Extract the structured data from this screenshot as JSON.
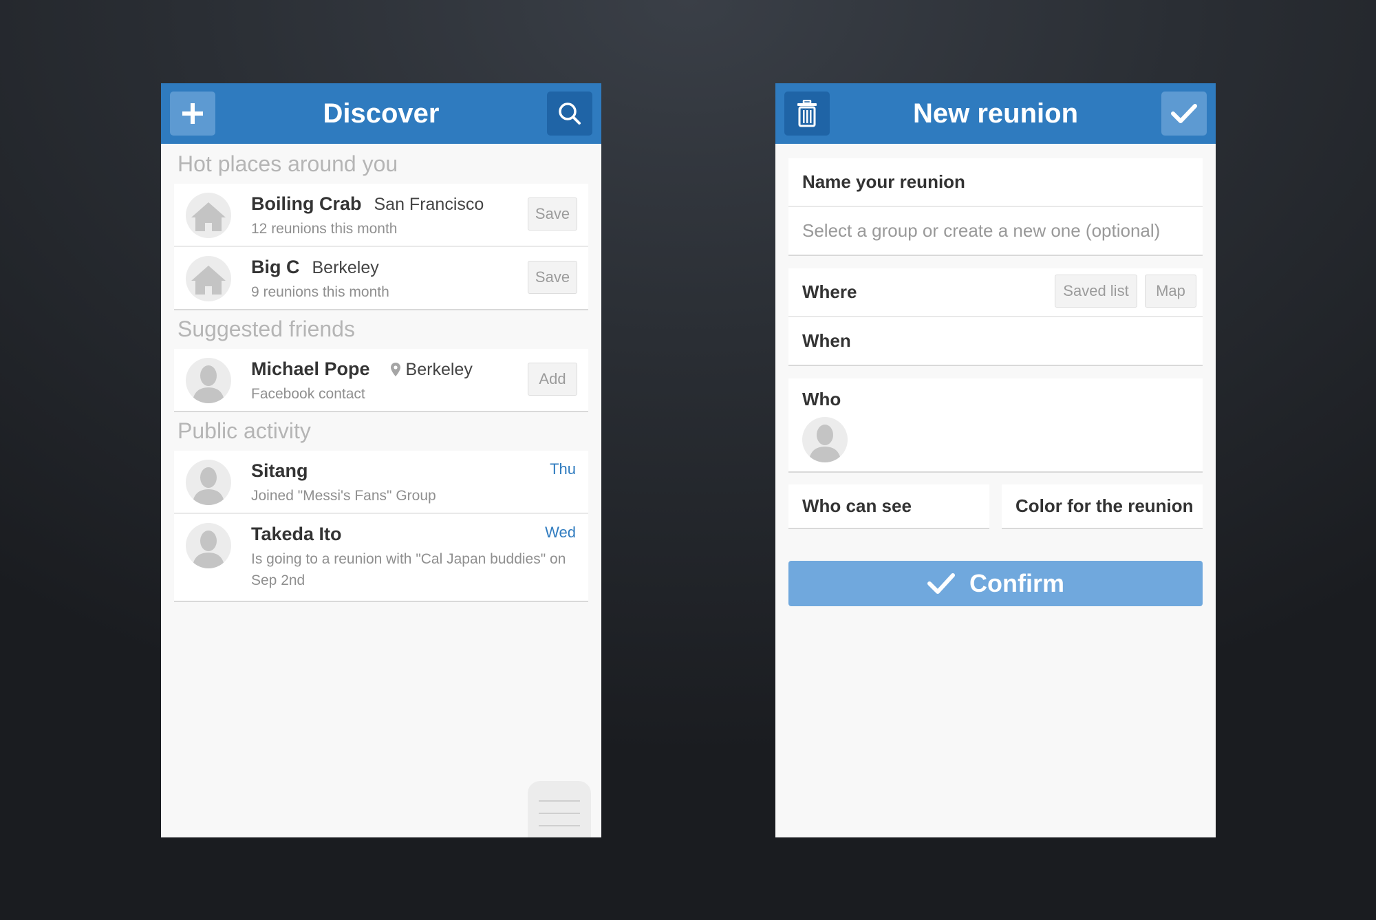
{
  "discover": {
    "title": "Discover",
    "add_icon": "plus-icon",
    "search_icon": "search-icon",
    "sections": {
      "hot_places": "Hot places around you",
      "suggested_friends": "Suggested friends",
      "public_activity": "Public activity"
    },
    "places": [
      {
        "name": "Boiling Crab",
        "location": "San Francisco",
        "stats": "12 reunions this month",
        "action": "Save"
      },
      {
        "name": "Big C",
        "location": "Berkeley",
        "stats": "9 reunions this month",
        "action": "Save"
      }
    ],
    "friends": [
      {
        "name": "Michael Pope",
        "location": "Berkeley",
        "source": "Facebook contact",
        "action": "Add"
      }
    ],
    "activity": [
      {
        "name": "Sitang",
        "day": "Thu",
        "text": "Joined \"Messi's Fans\" Group"
      },
      {
        "name": "Takeda Ito",
        "day": "Wed",
        "text": "Is going to a reunion with \"Cal Japan buddies\" on Sep 2nd"
      }
    ]
  },
  "new_reunion": {
    "title": "New reunion",
    "delete_icon": "trash-icon",
    "confirm_icon": "checkmark-icon",
    "name_label": "Name your reunion",
    "group_placeholder": "Select a group or create a new one (optional)",
    "where_label": "Where",
    "saved_list_label": "Saved list",
    "map_label": "Map",
    "when_label": "When",
    "who_label": "Who",
    "who_can_see_label": "Who can see",
    "color_label": "Color for the reunion",
    "confirm_label": "Confirm"
  },
  "colors": {
    "header": "#2f7bbf",
    "header_button_light": "#5d9ad2",
    "header_button_dark": "#1f64a6",
    "confirm_button": "#70a8dd",
    "day_text": "#2f7bbf"
  }
}
